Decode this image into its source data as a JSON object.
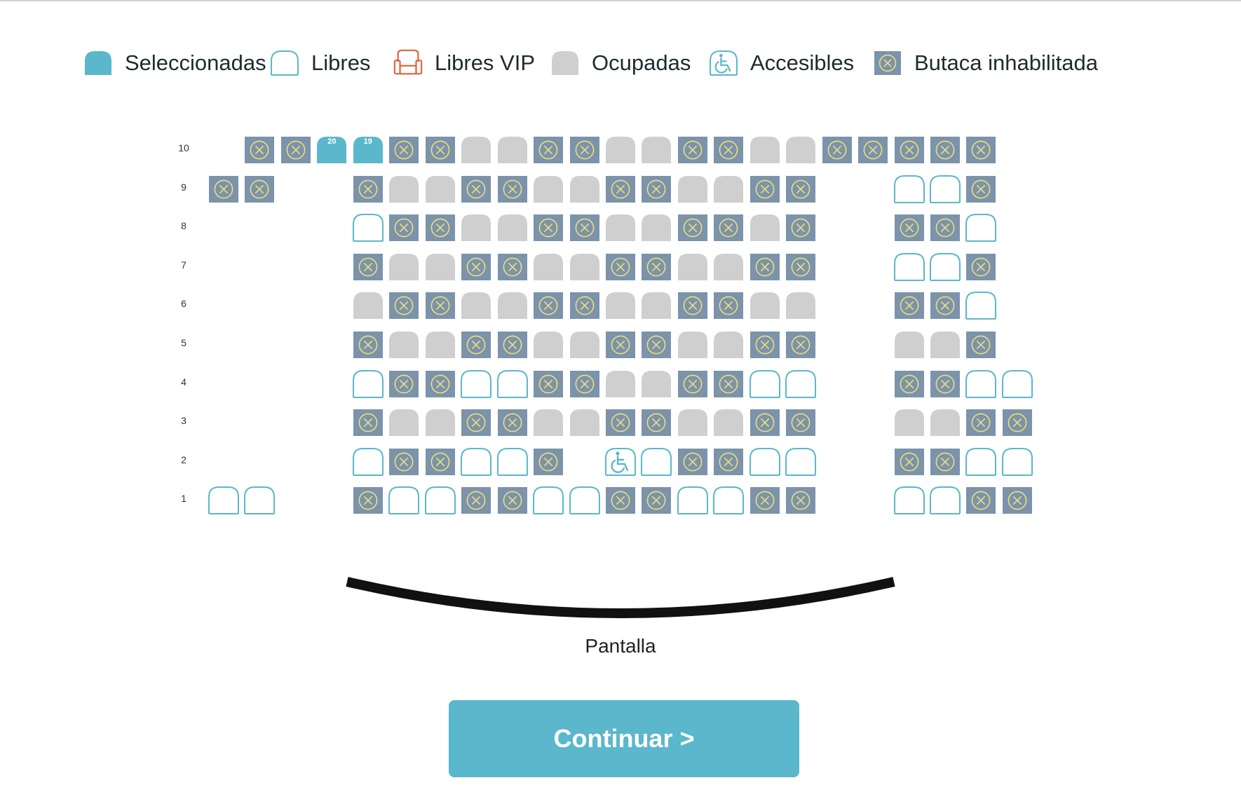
{
  "colors": {
    "accent": "#5bb7cb",
    "free_outline": "#5bb7cb",
    "vip_outline": "#e0603a",
    "occupied": "#cfcfcf",
    "disabled_bg": "#7b93ab",
    "disabled_mark": "#f0de76",
    "screen": "#111111"
  },
  "legend": [
    {
      "type": "selected",
      "label": "Seleccionadas",
      "icon": "seat-selected-icon"
    },
    {
      "type": "free",
      "label": "Libres",
      "icon": "seat-free-icon"
    },
    {
      "type": "vip",
      "label": "Libres VIP",
      "icon": "armchair-vip-icon"
    },
    {
      "type": "occupied",
      "label": "Ocupadas",
      "icon": "seat-occupied-icon"
    },
    {
      "type": "accessible",
      "label": "Accesibles",
      "icon": "wheelchair-icon"
    },
    {
      "type": "disabled",
      "label": "Butaca inhabilitada",
      "icon": "seat-disabled-icon"
    }
  ],
  "seat_map": {
    "legend_codes": {
      "S": "selected",
      "F": "free",
      "O": "occupied",
      "X": "disabled",
      "A": "accessible",
      ".": "empty"
    },
    "rows": [
      {
        "label": "10",
        "seats": ".XXSSXXOOXXOOXXOOXXXXX.",
        "seat_numbers": {
          "3": "20",
          "4": "19"
        }
      },
      {
        "label": "9",
        "seats": "XX..XOOXXOOXXOOXX..FFX."
      },
      {
        "label": "8",
        "seats": "....FXXOOXXOOXXOX..XXF."
      },
      {
        "label": "7",
        "seats": "....XOOXXOOXXOOXX..FFX."
      },
      {
        "label": "6",
        "seats": "....OXXOOXXOOXXOO..XXF."
      },
      {
        "label": "5",
        "seats": "....XOOXXOOXXOOXX..OOX."
      },
      {
        "label": "4",
        "seats": "....FXXFFXXOOXXFF..XXFF"
      },
      {
        "label": "3",
        "seats": "....XOOXXOOXXOOXX..OOXX"
      },
      {
        "label": "2",
        "seats": "....FXXFFX.AFXXFF..XXFF"
      },
      {
        "label": "1",
        "seats": "FF..XFFXXFFXXFFXX..FFXX"
      }
    ]
  },
  "screen": {
    "label": "Pantalla"
  },
  "actions": {
    "continue_label": "Continuar >"
  }
}
